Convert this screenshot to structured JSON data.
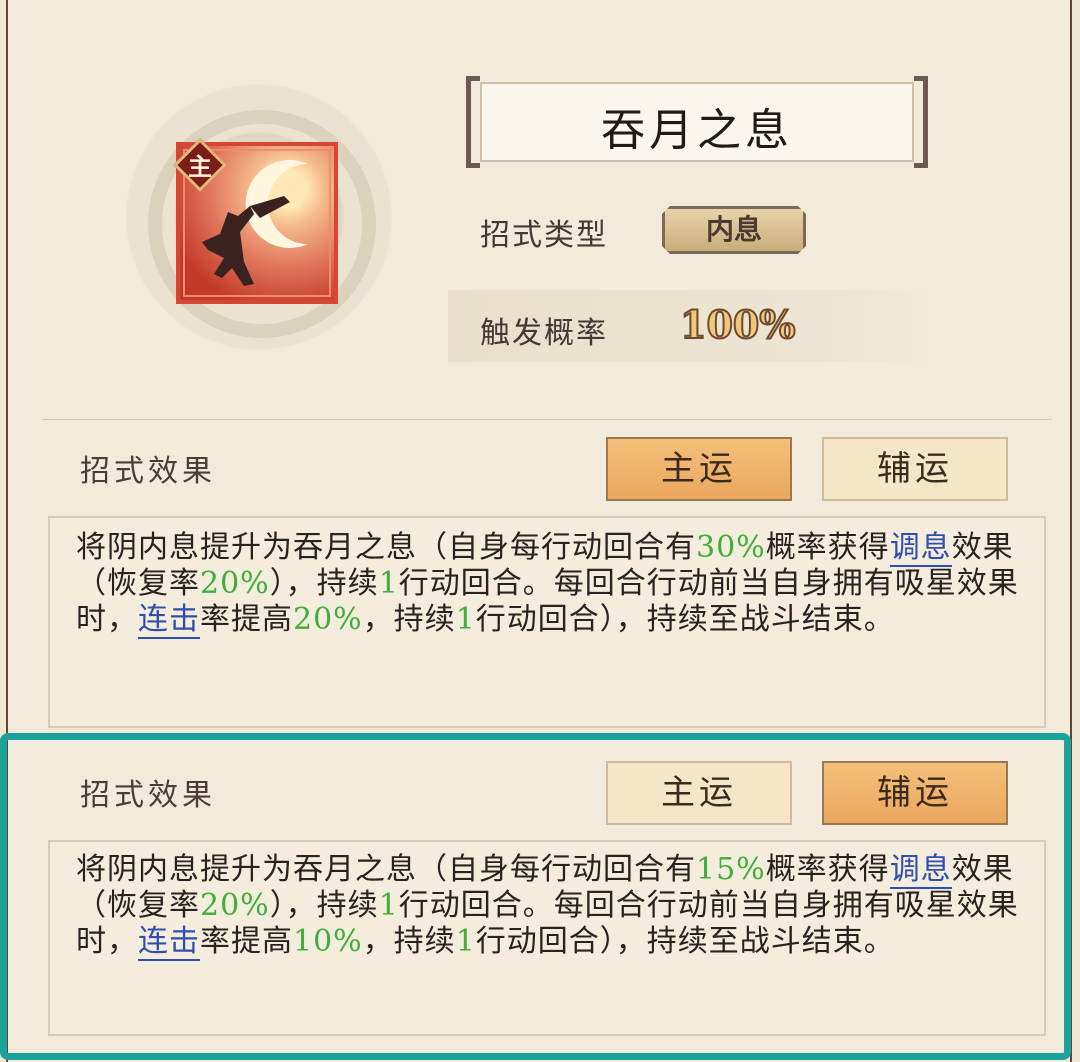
{
  "skill": {
    "name": "吞月之息",
    "badge": "主",
    "type_label": "招式类型",
    "type_value": "内息",
    "rate_label": "触发概率",
    "rate_value": "100%"
  },
  "panels": [
    {
      "section_label": "招式效果",
      "tab_main": "主运",
      "tab_aux": "辅运",
      "active_tab": "主运",
      "desc": {
        "p1": "将阴内息提升为吞月之息（自身每行动回合有",
        "n1": "30%",
        "p2": "概率获得",
        "link1": "调息",
        "p3": "效果（恢复率",
        "n2": "20%",
        "p4": "），持续",
        "n3": "1",
        "p5": "行动回合。每回合行动前当自身拥有吸星效果时，",
        "link2": "连击",
        "p6": "率提高",
        "n4": "20%",
        "p7": "，持续",
        "n5": "1",
        "p8": "行动回合），持续至战斗结束。"
      }
    },
    {
      "section_label": "招式效果",
      "tab_main": "主运",
      "tab_aux": "辅运",
      "active_tab": "辅运",
      "desc": {
        "p1": "将阴内息提升为吞月之息（自身每行动回合有",
        "n1": "15%",
        "p2": "概率获得",
        "link1": "调息",
        "p3": "效果（恢复率",
        "n2": "20%",
        "p4": "），持续",
        "n3": "1",
        "p5": "行动回合。每回合行动前当自身拥有吸星效果时，",
        "link2": "连击",
        "p6": "率提高",
        "n4": "10%",
        "p7": "，持续",
        "n5": "1",
        "p8": "行动回合），持续至战斗结束。"
      }
    }
  ],
  "colors": {
    "highlight_border": "#1aa39a",
    "number_green": "#3fae3a",
    "link_blue": "#2f4fae",
    "active_tab": "#eaa75e"
  }
}
